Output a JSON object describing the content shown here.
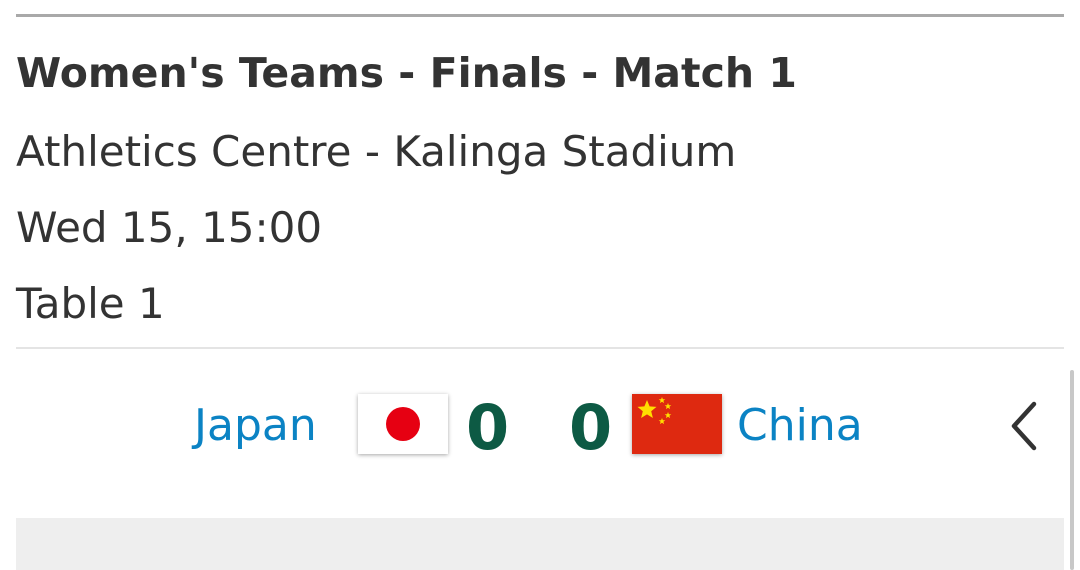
{
  "match": {
    "title": "Women's Teams - Finals - Match 1",
    "venue": "Athletics Centre - Kalinga Stadium",
    "datetime": "Wed 15, 15:00",
    "table": "Table 1"
  },
  "home": {
    "name": "Japan",
    "score": "0",
    "flag_icon": "japan-flag-icon"
  },
  "away": {
    "name": "China",
    "score": "0",
    "flag_icon": "china-flag-icon"
  },
  "colors": {
    "team_name": "#0b83c4",
    "score": "#0d5a44",
    "text": "#333333"
  },
  "icons": {
    "nav": "chevron-left-icon"
  }
}
